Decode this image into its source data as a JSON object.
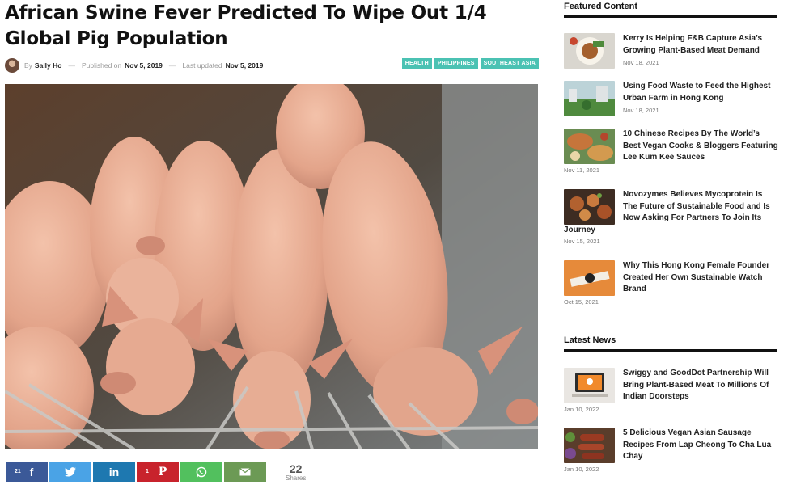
{
  "article": {
    "title": "African Swine Fever Predicted To Wipe Out 1/4 Global Pig Population",
    "by_label": "By",
    "author": "Sally Ho",
    "published_label": "Published on",
    "published": "Nov 5, 2019",
    "updated_label": "Last updated",
    "updated": "Nov 5, 2019",
    "separator": "—",
    "tags": [
      "HEALTH",
      "PHILIPPINES",
      "SOUTHEAST ASIA"
    ]
  },
  "share": {
    "facebook_count": "21",
    "pinterest_count": "1",
    "total": "22",
    "total_label": "Shares"
  },
  "sidebar": {
    "featured_heading": "Featured Content",
    "featured": [
      {
        "title": "Kerry Is Helping F&B Capture Asia’s Growing Plant-Based Meat Demand",
        "date": "Nov 18, 2021"
      },
      {
        "title": "Using Food Waste to Feed the Highest Urban Farm in Hong Kong",
        "date": "Nov 18, 2021"
      },
      {
        "title": "10 Chinese Recipes By The World’s Best Vegan Cooks & Bloggers Featuring Lee Kum Kee Sauces",
        "date": "Nov 11, 2021"
      },
      {
        "title": "Novozymes Believes Mycoprotein Is The Future of Sustainable Food and Is Now Asking For Partners To Join Its",
        "title_tail": "Journey",
        "date": "Nov 15, 2021"
      },
      {
        "title": "Why This Hong Kong Female Founder Created Her Own Sustainable Watch Brand",
        "date": "Oct 15, 2021"
      }
    ],
    "latest_heading": "Latest News",
    "latest": [
      {
        "title": "Swiggy and GoodDot Partnership Will Bring Plant-Based Meat To Millions Of Indian Doorsteps",
        "date": "Jan 10, 2022"
      },
      {
        "title": "5 Delicious Vegan Asian Sausage Recipes From Lap Cheong To Cha Lua Chay",
        "date": "Jan 10, 2022"
      }
    ]
  }
}
